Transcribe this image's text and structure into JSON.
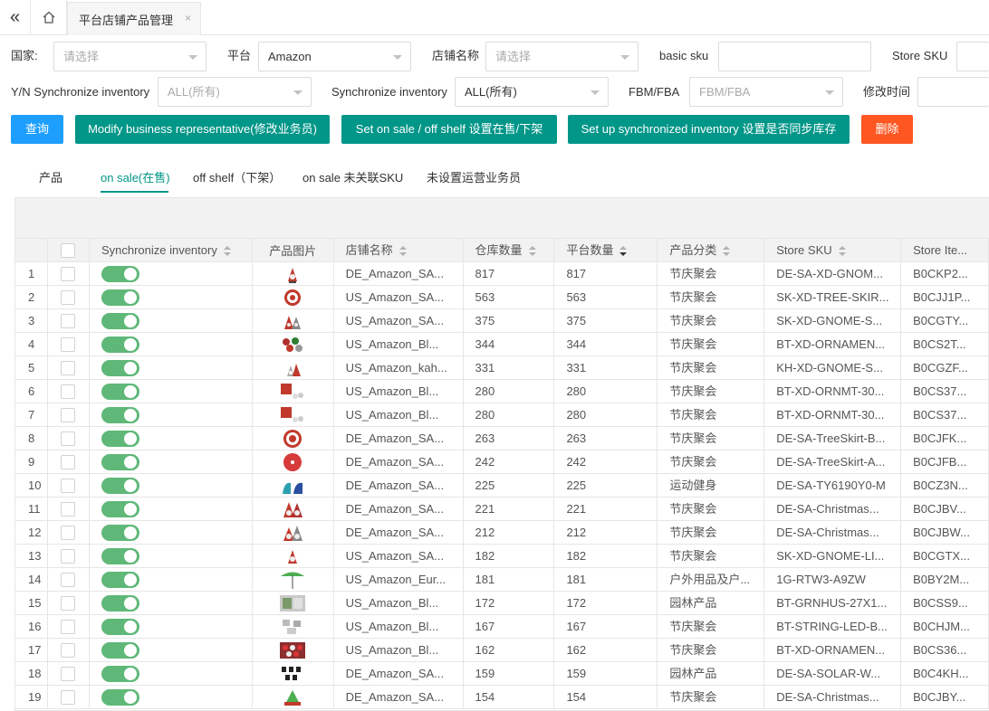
{
  "tabbar": {
    "collapse_glyph": "«",
    "home_glyph": "⌂",
    "tab_label": "平台店铺产品管理",
    "close_glyph": "×"
  },
  "filters": {
    "country": {
      "label": "国家:",
      "placeholder": "请选择"
    },
    "platform": {
      "label": "平台",
      "value": "Amazon"
    },
    "store_name": {
      "label": "店铺名称",
      "placeholder": "请选择"
    },
    "basic_sku": {
      "label": "basic sku",
      "value": ""
    },
    "store_sku": {
      "label": "Store SKU",
      "value": ""
    },
    "yn_sync": {
      "label": "Y/N Synchronize inventory",
      "placeholder": "ALL(所有)"
    },
    "sync_inventory": {
      "label": "Synchronize inventory",
      "value": "ALL(所有)"
    },
    "fbm_fba": {
      "label": "FBM/FBA",
      "placeholder": "FBM/FBA"
    },
    "modified_time": {
      "label": "修改时间",
      "value": ""
    }
  },
  "buttons": {
    "query": "查询",
    "modify_rep": "Modify business representative(修改业务员)",
    "set_on_sale": "Set on sale / off shelf 设置在售/下架",
    "set_sync": "Set up synchronized inventory 设置是否同步库存",
    "delete": "删除"
  },
  "subtabs": [
    "产品",
    "on sale(在售)",
    "off shelf（下架）",
    "on sale 未关联SKU",
    "未设置运营业务员"
  ],
  "table": {
    "headers": {
      "sync": "Synchronize inventory",
      "img": "产品图片",
      "store": "店铺名称",
      "warehouse_qty": "仓库数量",
      "platform_qty": "平台数量",
      "category": "产品分类",
      "store_sku": "Store SKU",
      "store_item": "Store Ite..."
    },
    "rows": [
      {
        "idx": "1",
        "store": "DE_Amazon_SA...",
        "wh": "817",
        "plat": "817",
        "cat": "节庆聚会",
        "sku": "DE-SA-XD-GNOM...",
        "item": "B0CKP2..."
      },
      {
        "idx": "2",
        "store": "US_Amazon_SA...",
        "wh": "563",
        "plat": "563",
        "cat": "节庆聚会",
        "sku": "SK-XD-TREE-SKIR...",
        "item": "B0CJJ1P..."
      },
      {
        "idx": "3",
        "store": "US_Amazon_SA...",
        "wh": "375",
        "plat": "375",
        "cat": "节庆聚会",
        "sku": "SK-XD-GNOME-S...",
        "item": "B0CGTY..."
      },
      {
        "idx": "4",
        "store": "US_Amazon_Bl...",
        "wh": "344",
        "plat": "344",
        "cat": "节庆聚会",
        "sku": "BT-XD-ORNAMEN...",
        "item": "B0CS2T..."
      },
      {
        "idx": "5",
        "store": "US_Amazon_kah...",
        "wh": "331",
        "plat": "331",
        "cat": "节庆聚会",
        "sku": "KH-XD-GNOME-S...",
        "item": "B0CGZF..."
      },
      {
        "idx": "6",
        "store": "US_Amazon_Bl...",
        "wh": "280",
        "plat": "280",
        "cat": "节庆聚会",
        "sku": "BT-XD-ORNMT-30...",
        "item": "B0CS37..."
      },
      {
        "idx": "7",
        "store": "US_Amazon_Bl...",
        "wh": "280",
        "plat": "280",
        "cat": "节庆聚会",
        "sku": "BT-XD-ORNMT-30...",
        "item": "B0CS37..."
      },
      {
        "idx": "8",
        "store": "DE_Amazon_SA...",
        "wh": "263",
        "plat": "263",
        "cat": "节庆聚会",
        "sku": "DE-SA-TreeSkirt-B...",
        "item": "B0CJFK..."
      },
      {
        "idx": "9",
        "store": "DE_Amazon_SA...",
        "wh": "242",
        "plat": "242",
        "cat": "节庆聚会",
        "sku": "DE-SA-TreeSkirt-A...",
        "item": "B0CJFB..."
      },
      {
        "idx": "10",
        "store": "DE_Amazon_SA...",
        "wh": "225",
        "plat": "225",
        "cat": "运动健身",
        "sku": "DE-SA-TY6190Y0-M",
        "item": "B0CZ3N..."
      },
      {
        "idx": "11",
        "store": "DE_Amazon_SA...",
        "wh": "221",
        "plat": "221",
        "cat": "节庆聚会",
        "sku": "DE-SA-Christmas...",
        "item": "B0CJBV..."
      },
      {
        "idx": "12",
        "store": "DE_Amazon_SA...",
        "wh": "212",
        "plat": "212",
        "cat": "节庆聚会",
        "sku": "DE-SA-Christmas...",
        "item": "B0CJBW..."
      },
      {
        "idx": "13",
        "store": "US_Amazon_SA...",
        "wh": "182",
        "plat": "182",
        "cat": "节庆聚会",
        "sku": "SK-XD-GNOME-LI...",
        "item": "B0CGTX..."
      },
      {
        "idx": "14",
        "store": "US_Amazon_Eur...",
        "wh": "181",
        "plat": "181",
        "cat": "户外用品及户...",
        "sku": "1G-RTW3-A9ZW",
        "item": "B0BY2M..."
      },
      {
        "idx": "15",
        "store": "US_Amazon_Bl...",
        "wh": "172",
        "plat": "172",
        "cat": "园林产品",
        "sku": "BT-GRNHUS-27X1...",
        "item": "B0CSS9..."
      },
      {
        "idx": "16",
        "store": "US_Amazon_Bl...",
        "wh": "167",
        "plat": "167",
        "cat": "节庆聚会",
        "sku": "BT-STRING-LED-B...",
        "item": "B0CHJM..."
      },
      {
        "idx": "17",
        "store": "US_Amazon_Bl...",
        "wh": "162",
        "plat": "162",
        "cat": "节庆聚会",
        "sku": "BT-XD-ORNAMEN...",
        "item": "B0CS36..."
      },
      {
        "idx": "18",
        "store": "DE_Amazon_SA...",
        "wh": "159",
        "plat": "159",
        "cat": "园林产品",
        "sku": "DE-SA-SOLAR-W...",
        "item": "B0C4KH..."
      },
      {
        "idx": "19",
        "store": "DE_Amazon_SA...",
        "wh": "154",
        "plat": "154",
        "cat": "节庆聚会",
        "sku": "DE-SA-Christmas...",
        "item": "B0CJBY..."
      }
    ]
  },
  "colors": {
    "accent": "#009688",
    "query_button": "#1e9fff",
    "delete_button": "#ff5722",
    "toggle_on": "#5fb878"
  }
}
